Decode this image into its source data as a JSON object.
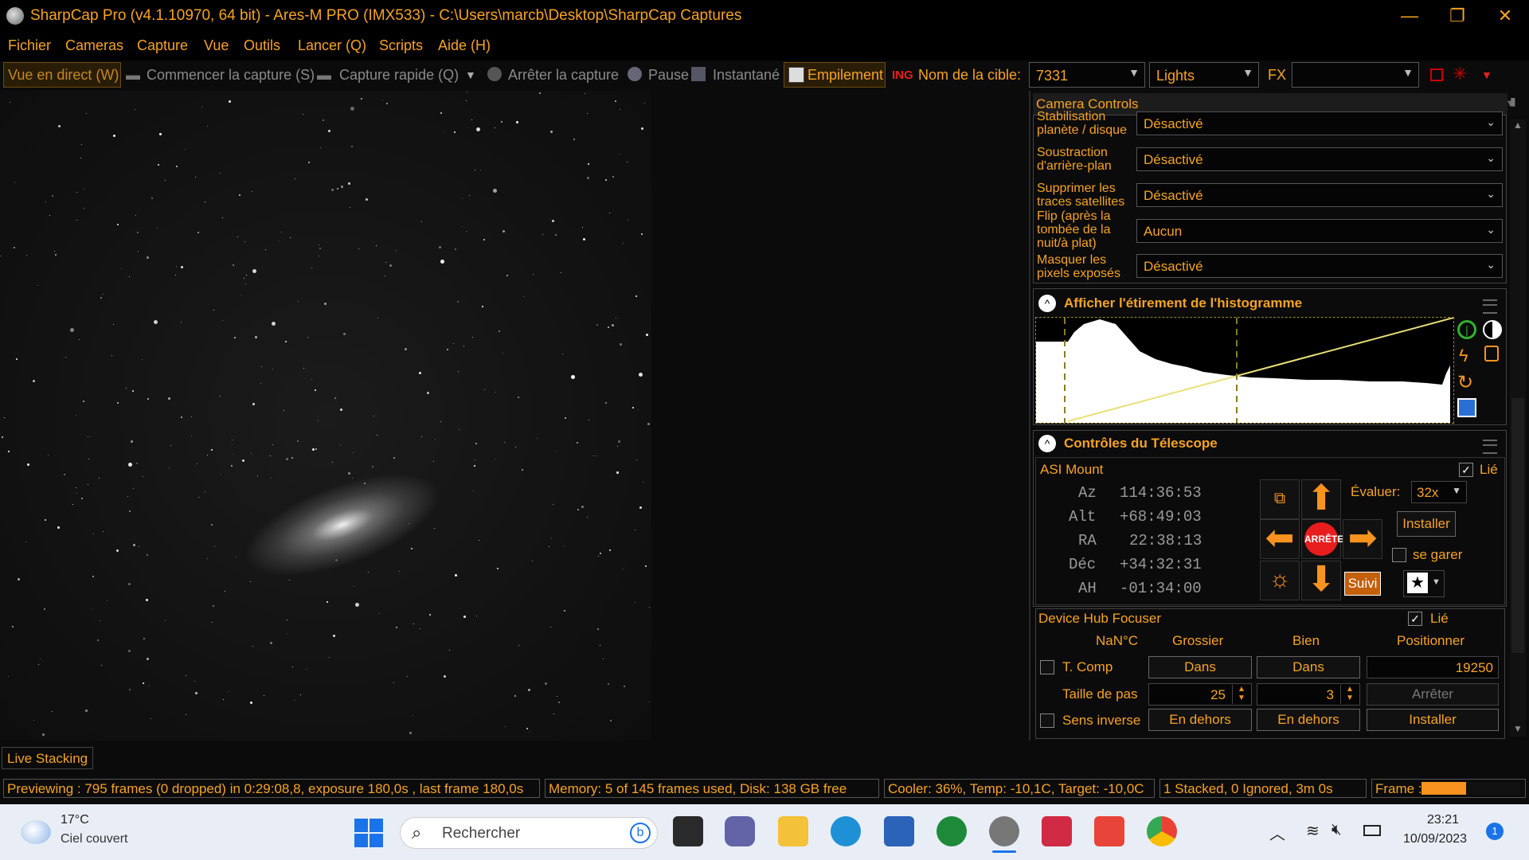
{
  "window": {
    "title": "SharpCap Pro (v4.1.10970, 64 bit) - Ares-M PRO (IMX533) - C:\\Users\\marcb\\Desktop\\SharpCap Captures",
    "min": "—",
    "max": "❐",
    "close": "✕"
  },
  "menu": [
    "Fichier",
    "Cameras",
    "Capture",
    "Vue",
    "Outils",
    "Lancer (Q)",
    "Scripts",
    "Aide (H)"
  ],
  "toolbar": {
    "live": "Vue en direct (W)",
    "start": "Commencer la capture (S)",
    "quick": "Capture rapide (Q)",
    "stop": "Arrêter la capture",
    "pause": "Pause",
    "snapshot": "Instantané",
    "stacking": "Empilement",
    "target_label": "Nom de la cible:",
    "target_value": "7331",
    "frame_type": "Lights",
    "fx_label": "FX",
    "fx_value": ""
  },
  "panel": {
    "title": "Camera Controls",
    "rows": [
      {
        "label": "Stabilisation planète / disque",
        "value": "Désactivé"
      },
      {
        "label": "Soustraction d'arrière-plan",
        "value": "Désactivé"
      },
      {
        "label": "Supprimer les traces satellites",
        "value": "Désactivé"
      },
      {
        "label": "Flip (après la tombée de la nuit/à plat)",
        "value": "Aucun"
      },
      {
        "label": "Masquer les pixels exposés",
        "value": "Désactivé"
      }
    ],
    "histogram_title": "Afficher l'étirement de l'histogramme",
    "telescope_title": "Contrôles du Télescope",
    "mount": {
      "name": "ASI Mount",
      "linked": "Lié",
      "az_label": "Az",
      "az": "114:36:53",
      "alt_label": "Alt",
      "alt": "+68:49:03",
      "ra_label": "RA",
      "ra": "22:38:13",
      "dec_label": "Déc",
      "dec": "+34:32:31",
      "ah_label": "AH",
      "ah": "-01:34:00",
      "stop": "ARRÊTE",
      "rate_label": "Évaluer:",
      "rate": "32x",
      "install": "Installer",
      "park": "se garer",
      "track": "Suivi"
    },
    "focuser": {
      "name": "Device Hub Focuser",
      "linked": "Lié",
      "temp": "NaN°C",
      "coarse": "Grossier",
      "fine": "Bien",
      "position_label": "Positionner",
      "tcomp": "T. Comp",
      "in1": "Dans",
      "in2": "Dans",
      "position": "19250",
      "step_label": "Taille de pas",
      "step_coarse": "25",
      "step_fine": "3",
      "stop": "Arrêter",
      "reverse": "Sens inverse",
      "out1": "En dehors",
      "out2": "En dehors",
      "install": "Installer"
    }
  },
  "live_stacking_tab": "Live Stacking",
  "status": {
    "preview": "Previewing : 795 frames (0 dropped) in 0:29:08,8, exposure 180,0s , last frame 180,0s",
    "memory": "Memory: 5 of 145 frames used, Disk: 138 GB free",
    "cooler": "Cooler: 36%, Temp: -10,1C, Target: -10,0C",
    "stacked": "1 Stacked, 0 Ignored, 3m 0s",
    "frame": "Frame :",
    "frame_progress": 0.45
  },
  "taskbar": {
    "weather_temp": "17°C",
    "weather_desc": "Ciel couvert",
    "search_placeholder": "Rechercher",
    "time": "23:21",
    "date": "10/09/2023",
    "notif": "1"
  },
  "colors": {
    "accent": "#f6a323",
    "arrows": "#f7931e",
    "stop_red": "#e81d1d",
    "hist_line": "#e9e07a"
  }
}
